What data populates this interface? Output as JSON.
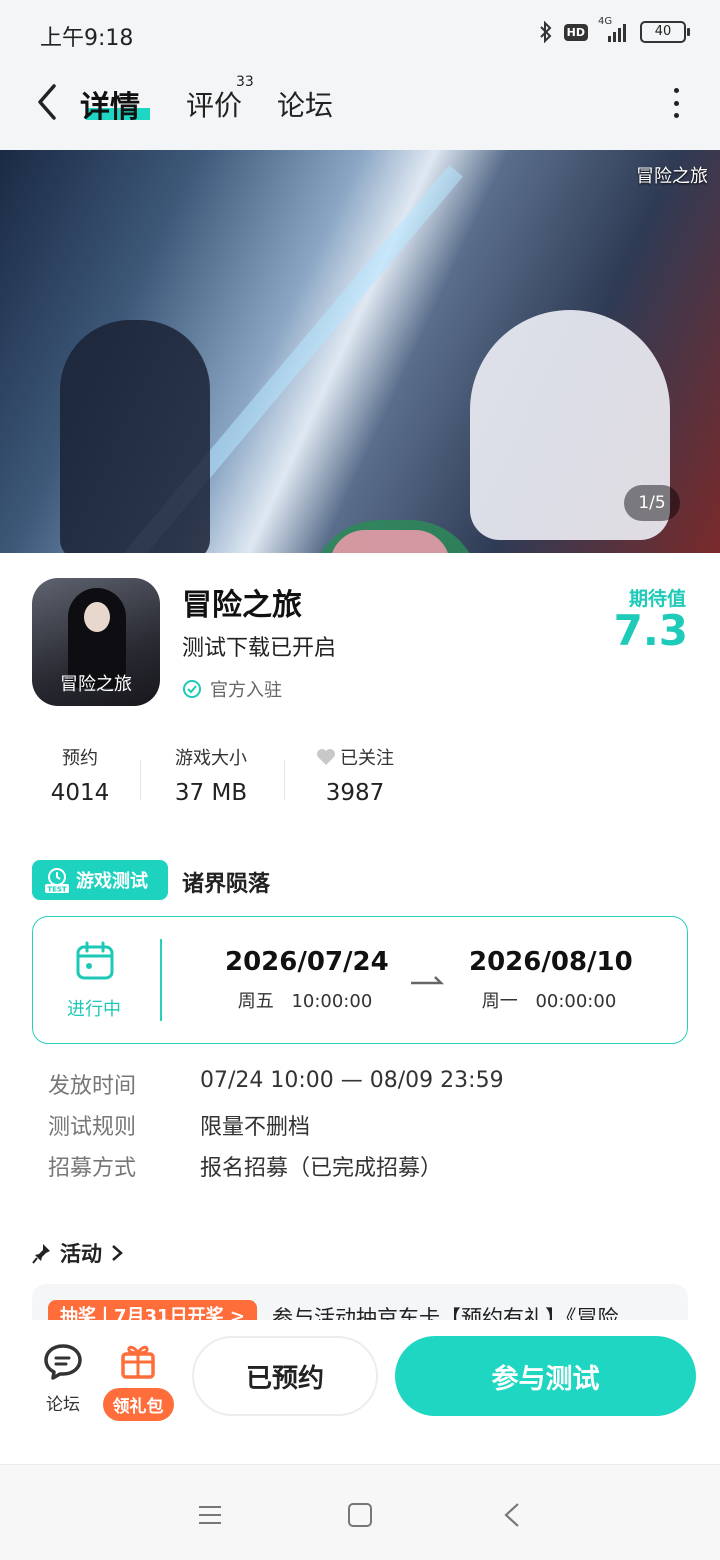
{
  "status_bar": {
    "time": "上午9:18",
    "hd_label": "HD",
    "network": "4G",
    "battery": "40"
  },
  "header": {
    "tabs": [
      {
        "label": "详情",
        "active": true
      },
      {
        "label": "评价",
        "count": "33"
      },
      {
        "label": "论坛"
      }
    ]
  },
  "banner": {
    "logo_text": "冒险之旅",
    "page_indicator": "1/5"
  },
  "app": {
    "icon_text": "冒险之旅",
    "name": "冒险之旅",
    "subtitle": "测试下载已开启",
    "official_label": "官方入驻",
    "expect_label": "期待值",
    "expect_value": "7.3"
  },
  "stats": [
    {
      "label": "预约",
      "value": "4014"
    },
    {
      "label": "游戏大小",
      "value": "37 MB"
    },
    {
      "label": "已关注",
      "value": "3987",
      "icon": "heart-icon"
    }
  ],
  "test": {
    "badge_label": "游戏测试",
    "badge_icon_text": "TEST",
    "name": "诸界陨落",
    "status": "进行中",
    "start_date": "2026/07/24",
    "start_weekday": "周五",
    "start_time": "10:00:00",
    "end_date": "2026/08/10",
    "end_weekday": "周一",
    "end_time": "00:00:00"
  },
  "details": [
    {
      "label": "发放时间",
      "value": "07/24 10:00 — 08/09 23:59"
    },
    {
      "label": "测试规则",
      "value": "限量不删档"
    },
    {
      "label": "招募方式",
      "value": "报名招募（已完成招募）"
    }
  ],
  "activity": {
    "title": "活动",
    "tag": "抽奖丨7月31日开奖 >",
    "item_title": "参与活动抽京东卡【预约有礼】《冒险"
  },
  "bottom_bar": {
    "forum_label": "论坛",
    "gift_label": "领礼包",
    "reserved_label": "已预约",
    "join_label": "参与测试"
  },
  "colors": {
    "accent": "#1ed6c4",
    "orange": "#ff6d3a",
    "text": "#222222"
  }
}
